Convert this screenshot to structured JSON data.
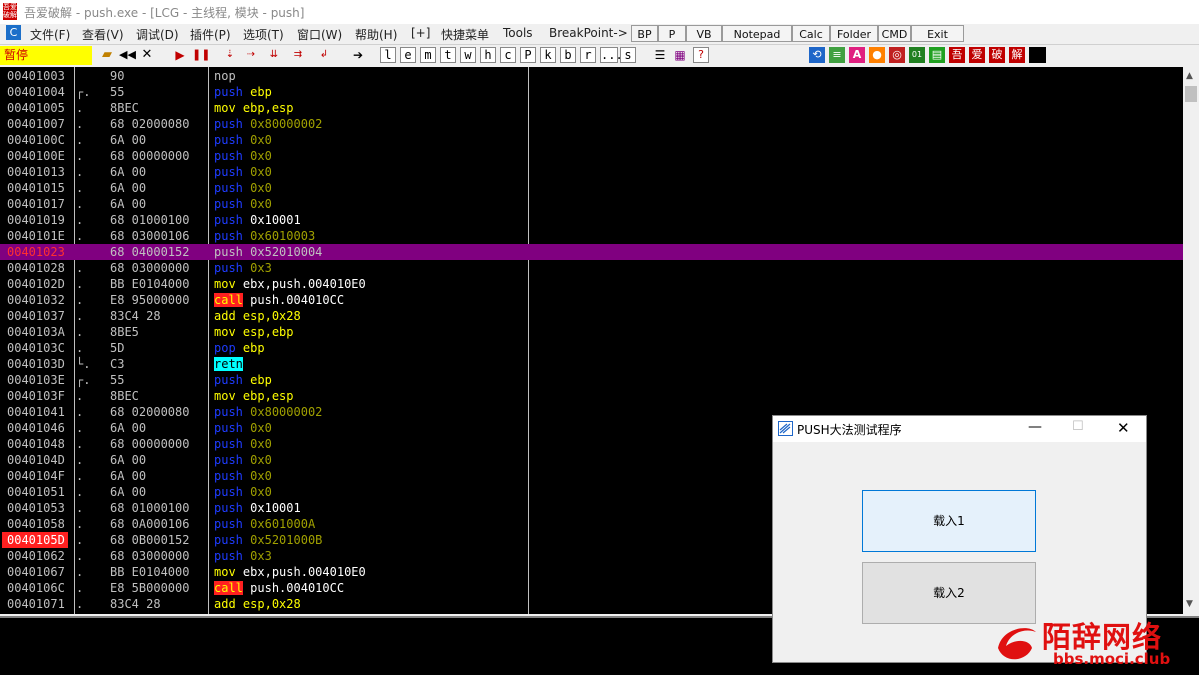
{
  "window": {
    "title": "吾爱破解 - push.exe - [LCG - 主线程, 模块 - push]",
    "app_icon_text": "吾爱破解"
  },
  "menu": {
    "system_btn": "C",
    "items": [
      "文件(F)",
      "查看(V)",
      "调试(D)",
      "插件(P)",
      "选项(T)",
      "窗口(W)",
      "帮助(H)",
      "[+]",
      "快捷菜单",
      "Tools",
      "BreakPoint->"
    ],
    "plugin_buttons": [
      "BP",
      "P",
      "VB",
      "Notepad",
      "Calc",
      "Folder",
      "CMD",
      "Exit"
    ]
  },
  "toolbar": {
    "status": "暂停",
    "letter_buttons": [
      "l",
      "e",
      "m",
      "t",
      "w",
      "h",
      "c",
      "P",
      "k",
      "b",
      "r",
      "...",
      "s"
    ],
    "right_icons_text": [
      "吾",
      "爱",
      "破",
      "解"
    ]
  },
  "disasm": [
    {
      "addr": "00401003",
      "mark": "",
      "hex": "90",
      "mn": "nop",
      "mc": "gray",
      "op": "",
      "oc": "gray",
      "hl": ""
    },
    {
      "addr": "00401004",
      "mark": "┌.",
      "hex": "55",
      "mn": "push",
      "mc": "blue",
      "op": "ebp",
      "oc": "yel",
      "hl": ""
    },
    {
      "addr": "00401005",
      "mark": ".",
      "hex": "8BEC",
      "mn": "mov",
      "mc": "yel",
      "op": "ebp,esp",
      "oc": "yel",
      "hl": ""
    },
    {
      "addr": "00401007",
      "mark": ".",
      "hex": "68 02000080",
      "mn": "push",
      "mc": "blue",
      "op": "0x80000002",
      "oc": "olive",
      "hl": ""
    },
    {
      "addr": "0040100C",
      "mark": ".",
      "hex": "6A 00",
      "mn": "push",
      "mc": "blue",
      "op": "0x0",
      "oc": "olive",
      "hl": ""
    },
    {
      "addr": "0040100E",
      "mark": ".",
      "hex": "68 00000000",
      "mn": "push",
      "mc": "blue",
      "op": "0x0",
      "oc": "olive",
      "hl": ""
    },
    {
      "addr": "00401013",
      "mark": ".",
      "hex": "6A 00",
      "mn": "push",
      "mc": "blue",
      "op": "0x0",
      "oc": "olive",
      "hl": ""
    },
    {
      "addr": "00401015",
      "mark": ".",
      "hex": "6A 00",
      "mn": "push",
      "mc": "blue",
      "op": "0x0",
      "oc": "olive",
      "hl": ""
    },
    {
      "addr": "00401017",
      "mark": ".",
      "hex": "6A 00",
      "mn": "push",
      "mc": "blue",
      "op": "0x0",
      "oc": "olive",
      "hl": ""
    },
    {
      "addr": "00401019",
      "mark": ".",
      "hex": "68 01000100",
      "mn": "push",
      "mc": "blue",
      "op": "0x10001",
      "oc": "white",
      "hl": ""
    },
    {
      "addr": "0040101E",
      "mark": ".",
      "hex": "68 03000106",
      "mn": "push",
      "mc": "blue",
      "op": "0x6010003",
      "oc": "olive",
      "hl": ""
    },
    {
      "addr": "00401023",
      "mark": "",
      "hex": "68 04000152",
      "mn": "push",
      "mc": "gray",
      "op": "0x52010004",
      "oc": "gray",
      "hl": "purple"
    },
    {
      "addr": "00401028",
      "mark": ".",
      "hex": "68 03000000",
      "mn": "push",
      "mc": "blue",
      "op": "0x3",
      "oc": "olive",
      "hl": ""
    },
    {
      "addr": "0040102D",
      "mark": ".",
      "hex": "BB E0104000",
      "mn": "mov",
      "mc": "yel",
      "op": "ebx,push.004010E0",
      "oc": "white",
      "hl": ""
    },
    {
      "addr": "00401032",
      "mark": ".",
      "hex": "E8 95000000",
      "mn": "call",
      "mc": "call",
      "op": "push.004010CC",
      "oc": "white",
      "hl": ""
    },
    {
      "addr": "00401037",
      "mark": ".",
      "hex": "83C4 28",
      "mn": "add",
      "mc": "yel",
      "op": "esp,0x28",
      "oc": "yel",
      "hl": ""
    },
    {
      "addr": "0040103A",
      "mark": ".",
      "hex": "8BE5",
      "mn": "mov",
      "mc": "yel",
      "op": "esp,ebp",
      "oc": "yel",
      "hl": ""
    },
    {
      "addr": "0040103C",
      "mark": ".",
      "hex": "5D",
      "mn": "pop",
      "mc": "blue",
      "op": "ebp",
      "oc": "yel",
      "hl": ""
    },
    {
      "addr": "0040103D",
      "mark": "└.",
      "hex": "C3",
      "mn": "retn",
      "mc": "retn",
      "op": "",
      "oc": "gray",
      "hl": ""
    },
    {
      "addr": "0040103E",
      "mark": "┌.",
      "hex": "55",
      "mn": "push",
      "mc": "blue",
      "op": "ebp",
      "oc": "yel",
      "hl": ""
    },
    {
      "addr": "0040103F",
      "mark": ".",
      "hex": "8BEC",
      "mn": "mov",
      "mc": "yel",
      "op": "ebp,esp",
      "oc": "yel",
      "hl": ""
    },
    {
      "addr": "00401041",
      "mark": ".",
      "hex": "68 02000080",
      "mn": "push",
      "mc": "blue",
      "op": "0x80000002",
      "oc": "olive",
      "hl": ""
    },
    {
      "addr": "00401046",
      "mark": ".",
      "hex": "6A 00",
      "mn": "push",
      "mc": "blue",
      "op": "0x0",
      "oc": "olive",
      "hl": ""
    },
    {
      "addr": "00401048",
      "mark": ".",
      "hex": "68 00000000",
      "mn": "push",
      "mc": "blue",
      "op": "0x0",
      "oc": "olive",
      "hl": ""
    },
    {
      "addr": "0040104D",
      "mark": ".",
      "hex": "6A 00",
      "mn": "push",
      "mc": "blue",
      "op": "0x0",
      "oc": "olive",
      "hl": ""
    },
    {
      "addr": "0040104F",
      "mark": ".",
      "hex": "6A 00",
      "mn": "push",
      "mc": "blue",
      "op": "0x0",
      "oc": "olive",
      "hl": ""
    },
    {
      "addr": "00401051",
      "mark": ".",
      "hex": "6A 00",
      "mn": "push",
      "mc": "blue",
      "op": "0x0",
      "oc": "olive",
      "hl": ""
    },
    {
      "addr": "00401053",
      "mark": ".",
      "hex": "68 01000100",
      "mn": "push",
      "mc": "blue",
      "op": "0x10001",
      "oc": "white",
      "hl": ""
    },
    {
      "addr": "00401058",
      "mark": ".",
      "hex": "68 0A000106",
      "mn": "push",
      "mc": "blue",
      "op": "0x601000A",
      "oc": "olive",
      "hl": ""
    },
    {
      "addr": "0040105D",
      "mark": ".",
      "hex": "68 0B000152",
      "mn": "push",
      "mc": "blue",
      "op": "0x5201000B",
      "oc": "olive",
      "hl": "red"
    },
    {
      "addr": "00401062",
      "mark": ".",
      "hex": "68 03000000",
      "mn": "push",
      "mc": "blue",
      "op": "0x3",
      "oc": "olive",
      "hl": ""
    },
    {
      "addr": "00401067",
      "mark": ".",
      "hex": "BB E0104000",
      "mn": "mov",
      "mc": "yel",
      "op": "ebx,push.004010E0",
      "oc": "white",
      "hl": ""
    },
    {
      "addr": "0040106C",
      "mark": ".",
      "hex": "E8 5B000000",
      "mn": "call",
      "mc": "call",
      "op": "push.004010CC",
      "oc": "white",
      "hl": ""
    },
    {
      "addr": "00401071",
      "mark": ".",
      "hex": "83C4 28",
      "mn": "add",
      "mc": "yel",
      "op": "esp,0x28",
      "oc": "yel",
      "hl": ""
    }
  ],
  "dialog": {
    "title": "PUSH大法测试程序",
    "button1": "载入1",
    "button2": "载入2"
  },
  "watermark": {
    "name": "陌辞网络",
    "url": "bbs.moci.club"
  },
  "colors": {
    "selected_row": "#800080",
    "breakpoint": "#ff2020",
    "status_bg": "#ffff00"
  }
}
